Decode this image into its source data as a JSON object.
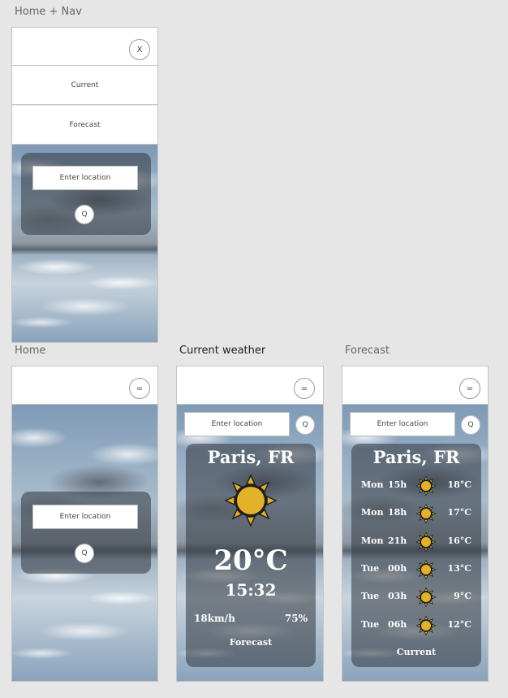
{
  "labels": {
    "home_nav": "Home + Nav",
    "home": "Home",
    "current_weather": "Current weather",
    "forecast": "Forecast"
  },
  "nav": {
    "close_label": "X",
    "menu_label": "=",
    "items": [
      "Current",
      "Forecast"
    ]
  },
  "search": {
    "placeholder": "Enter location",
    "button_label": "Q"
  },
  "current": {
    "city": "Paris, FR",
    "temperature": "20°C",
    "time": "15:32",
    "wind": "18km/h",
    "humidity": "75%",
    "link": "Forecast",
    "icon": "sun-icon"
  },
  "forecast": {
    "city": "Paris, FR",
    "rows": [
      {
        "day": "Mon",
        "hour": "15h",
        "temp": "18°C",
        "icon": "sun-icon"
      },
      {
        "day": "Mon",
        "hour": "18h",
        "temp": "17°C",
        "icon": "sun-icon"
      },
      {
        "day": "Mon",
        "hour": "21h",
        "temp": "16°C",
        "icon": "sun-icon"
      },
      {
        "day": "Tue",
        "hour": "00h",
        "temp": "13°C",
        "icon": "sun-icon"
      },
      {
        "day": "Tue",
        "hour": "03h",
        "temp": "9°C",
        "icon": "sun-icon"
      },
      {
        "day": "Tue",
        "hour": "06h",
        "temp": "12°C",
        "icon": "sun-icon"
      }
    ],
    "link": "Current"
  },
  "colors": {
    "background": "#e6e6e6",
    "panel": "#32373e",
    "sun": "#e3b12a"
  }
}
